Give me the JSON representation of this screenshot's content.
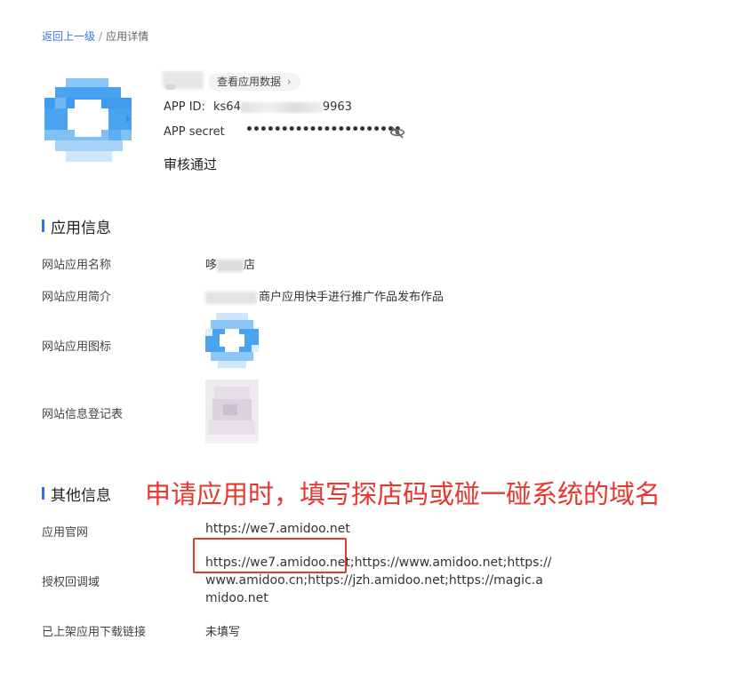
{
  "breadcrumb": {
    "back": "返回上一级",
    "separator": "/",
    "current": "应用详情"
  },
  "header": {
    "view_data_label": "查看应用数据",
    "app_id_label": "APP ID:",
    "app_id_prefix": "ks64",
    "app_id_suffix": "9963",
    "secret_label": "APP secret",
    "secret_value": "••••••••••••••••••••••",
    "status": "审核通过"
  },
  "app_info": {
    "title": "应用信息",
    "rows": [
      {
        "label": "网站应用名称",
        "value_prefix": "哆",
        "value_suffix": "店"
      },
      {
        "label": "网站应用简介",
        "value": "商户应用快手进行推广作品发布作品"
      },
      {
        "label": "网站应用图标"
      },
      {
        "label": "网站信息登记表"
      }
    ]
  },
  "other_info": {
    "title": "其他信息",
    "rows": [
      {
        "label": "应用官网",
        "value": "https://we7.amidoo.net"
      },
      {
        "label": "授权回调域",
        "value": "https://we7.amidoo.net;https://www.amidoo.net;https://www.amidoo.cn;https://jzh.amidoo.net;https://magic.amidoo.net"
      },
      {
        "label": "已上架应用下载链接",
        "value": "未填写"
      }
    ]
  },
  "annotation": "申请应用时，填写探店码或碰一碰系统的域名",
  "colors": {
    "accent": "#2f6bff",
    "link": "#3a74e5",
    "annotation": "#e8372c",
    "logo_blue": "#4aa3ef"
  }
}
